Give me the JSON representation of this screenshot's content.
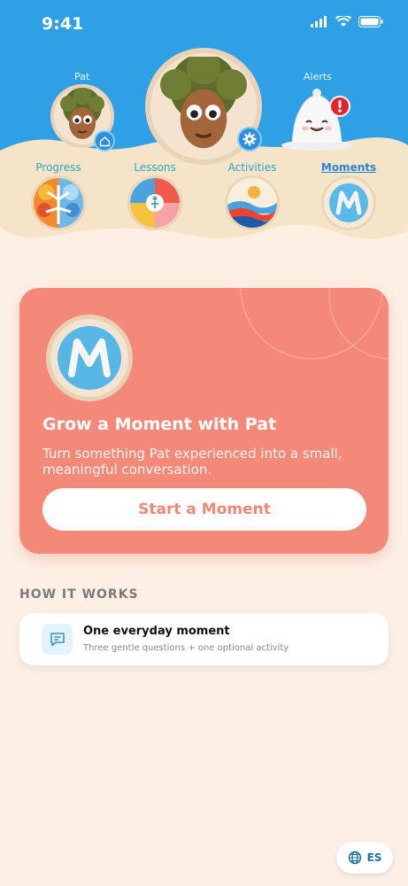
{
  "status": {
    "time": "9:41"
  },
  "profiles": {
    "left_label": "Pat",
    "right_label": "Alerts"
  },
  "nav": [
    {
      "label": "Progress"
    },
    {
      "label": "Lessons"
    },
    {
      "label": "Activities"
    },
    {
      "label": "Moments"
    }
  ],
  "card": {
    "logo_letter": "M",
    "title": "Grow a Moment with Pat",
    "subtitle": "Turn something Pat experienced into a small, meaningful conversation.",
    "button": "Start a Moment"
  },
  "how": {
    "section_title": "HOW IT WORKS",
    "item_title": "One everyday moment",
    "item_subtitle": "Three gentle questions + one optional activity"
  },
  "language": {
    "label": "ES"
  },
  "colors": {
    "header_blue": "#2f9fe6",
    "card": "#f4897a",
    "background": "#fdefe4"
  }
}
